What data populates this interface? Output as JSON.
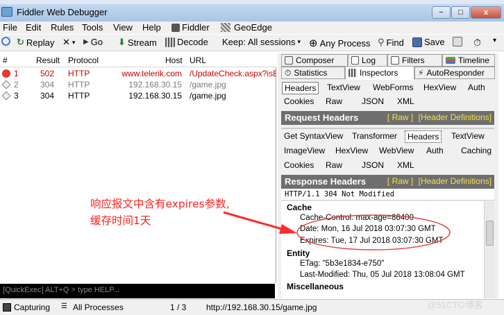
{
  "window": {
    "title": "Fiddler Web Debugger",
    "controls": [
      "−",
      "□",
      "x"
    ]
  },
  "menu": [
    "File",
    "Edit",
    "Rules",
    "Tools",
    "View",
    "Help",
    "Fiddler",
    "GeoEdge"
  ],
  "toolbar": {
    "replay": "Replay",
    "go": "Go",
    "stream": "Stream",
    "decode": "Decode",
    "keep": "Keep: All sessions",
    "process": "Any Process",
    "find": "Find",
    "save": "Save"
  },
  "sessions": {
    "columns": [
      "#",
      "Result",
      "Protocol",
      "Host",
      "URL"
    ],
    "rows": [
      {
        "num": "1",
        "result": "502",
        "protocol": "HTTP",
        "host": "www.telerik.com",
        "url": "/UpdateCheck.aspx?isBet",
        "style": "error"
      },
      {
        "num": "2",
        "result": "304",
        "protocol": "HTTP",
        "host": "192.168.30.15",
        "url": "/game.jpg",
        "style": "dim"
      },
      {
        "num": "3",
        "result": "304",
        "protocol": "HTTP",
        "host": "192.168.30.15",
        "url": "/game.jpg",
        "style": "normal"
      }
    ]
  },
  "quickexec": "[QuickExec] ALT+Q > type HELP...",
  "status": {
    "capturing": "Capturing",
    "processes": "All Processes",
    "count": "1 / 3",
    "url": "http://192.168.30.15/game.jpg"
  },
  "top_tabs": {
    "row1": [
      "Composer",
      "Log",
      "Filters",
      "Timeline"
    ],
    "row2": [
      "Statistics",
      "Inspectors",
      "AutoResponder"
    ]
  },
  "request_tabs": {
    "row1": [
      "Headers",
      "TextView",
      "WebForms",
      "HexView",
      "Auth"
    ],
    "row2": [
      "Cookies",
      "Raw",
      "JSON",
      "XML"
    ]
  },
  "request_headers": {
    "title": "Request Headers",
    "raw": "[ Raw ]",
    "defs": "[Header Definitions]"
  },
  "response_tabs": {
    "row1": [
      "Get SyntaxView",
      "Transformer",
      "Headers",
      "TextView"
    ],
    "row2": [
      "ImageView",
      "HexView",
      "WebView",
      "Auth",
      "Caching"
    ],
    "row3": [
      "Cookies",
      "Raw",
      "JSON",
      "XML"
    ]
  },
  "response_headers": {
    "title": "Response Headers",
    "raw": "[ Raw ]",
    "defs": "[Header Definitions]",
    "status_line": "HTTP/1.1 304 Not Modified"
  },
  "tree": {
    "cache_title": "Cache",
    "cache_control": "Cache-Control: max-age=86400",
    "date": "Date: Mon, 16 Jul 2018 03:07:30 GMT",
    "expires": "Expires: Tue, 17 Jul 2018 03:07:30 GMT",
    "entity_title": "Entity",
    "etag": "ETag: \"5b3e1834-e750\"",
    "last_modified": "Last-Modified: Thu, 05 Jul 2018 13:08:04 GMT",
    "misc_title": "Miscellaneous"
  },
  "annotation": {
    "line1": "响应报文中含有expires参数,",
    "line2": "缓存时间1天",
    "color": "#ff1f1f"
  },
  "watermark": "@51CTO博客"
}
